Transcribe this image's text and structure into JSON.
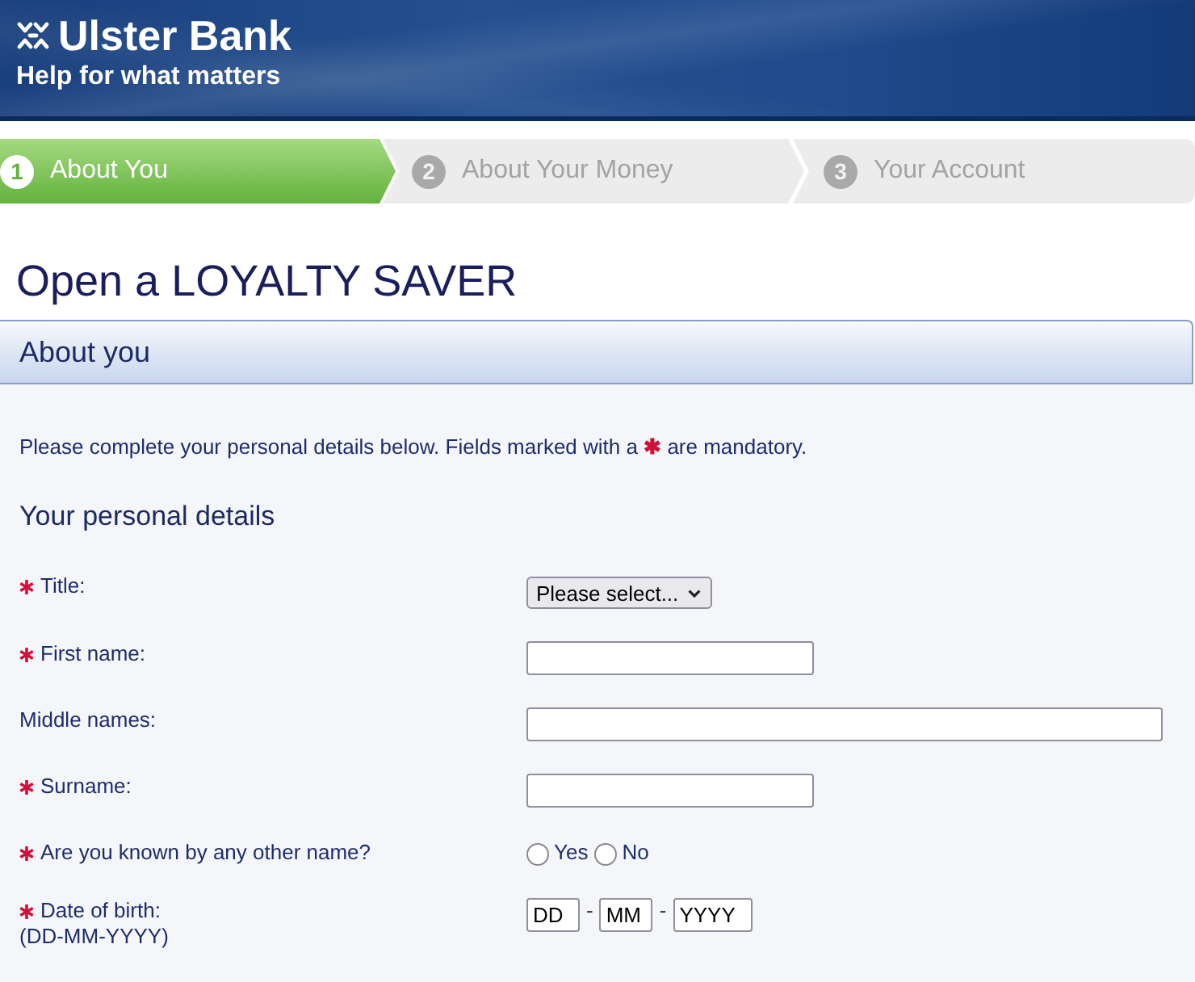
{
  "header": {
    "logo": "Ulster Bank",
    "tagline": "Help for what matters"
  },
  "steps": [
    {
      "number": "1",
      "label": "About You",
      "selected": true
    },
    {
      "number": "2",
      "label": "About Your Money",
      "selected": false
    },
    {
      "number": "3",
      "label": "Your Account",
      "selected": false
    }
  ],
  "page_title": "Open a LOYALTY SAVER",
  "section": {
    "title": "About you",
    "intro": "Please complete your personal details below. Fields marked with a **✱** are mandatory.",
    "subtitle": "Your personal details",
    "fields": [
      {
        "kind": "select",
        "label": "Title:",
        "required": true,
        "value": "Please select..."
      },
      {
        "kind": "text",
        "label": "First name:",
        "required": true,
        "wide": false
      },
      {
        "kind": "text",
        "label": "Middle names:",
        "required": false,
        "wide": true
      },
      {
        "kind": "text",
        "label": "Surname:",
        "required": true,
        "wide": false
      },
      {
        "kind": "radio",
        "label": "Are you known by any other name?",
        "required": true,
        "options": [
          {
            "label": "Yes",
            "selected": false
          },
          {
            "label": "No",
            "selected": false
          }
        ]
      },
      {
        "kind": "date",
        "label": "Date of birth:",
        "hint": "(DD-MM-YYYY)",
        "required": true,
        "parts": [
          {
            "kind": "input",
            "value": "DD"
          },
          {
            "kind": "separator",
            "text": "-"
          },
          {
            "kind": "input",
            "value": "MM"
          },
          {
            "kind": "separator",
            "text": "-"
          },
          {
            "kind": "input",
            "value": "YYYY"
          }
        ]
      }
    ]
  }
}
